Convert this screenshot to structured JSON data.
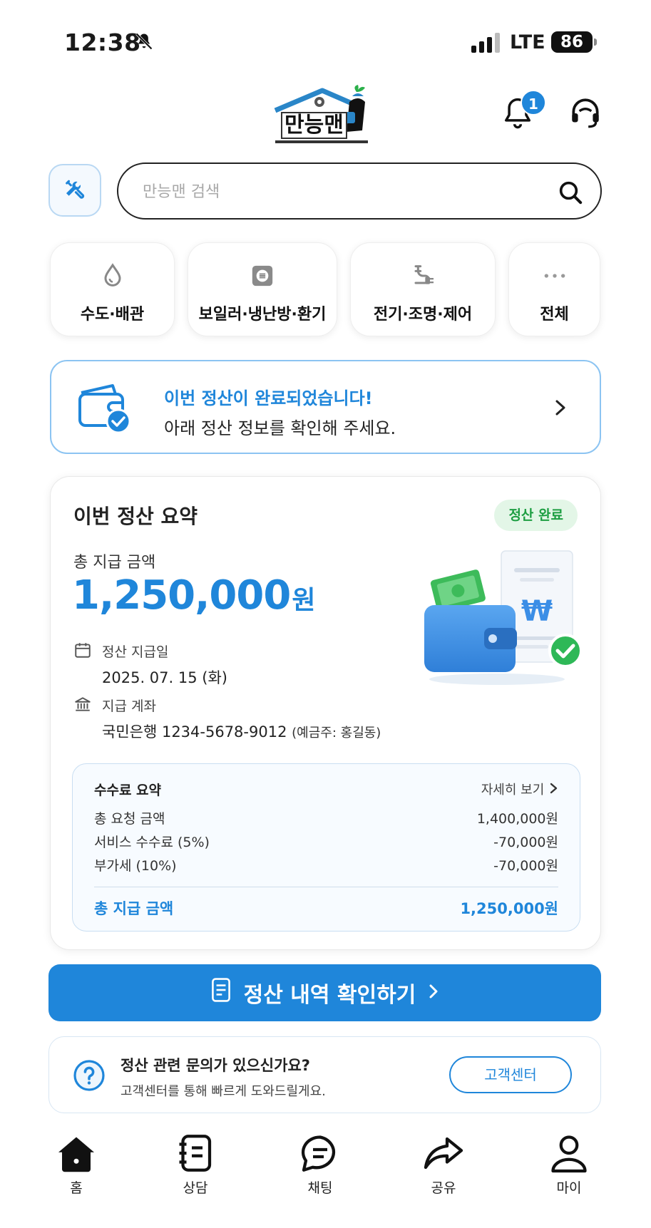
{
  "status_bar": {
    "time": "12:38",
    "network": "LTE",
    "battery": "86"
  },
  "header": {
    "logo_text": "만능맨",
    "notification_count": "1"
  },
  "search": {
    "placeholder": "만능맨 검색"
  },
  "categories": [
    {
      "label": "수도·배관",
      "icon": "water-drop-icon"
    },
    {
      "label": "보일러·냉난방·환기",
      "icon": "boiler-icon"
    },
    {
      "label": "전기·조명·제어",
      "icon": "plug-icon"
    },
    {
      "label": "전체",
      "icon": "more-dots-icon"
    }
  ],
  "notice": {
    "title": "이번 정산이 완료되었습니다!",
    "subtitle": "아래 정산 정보를 확인해 주세요."
  },
  "summary": {
    "title": "이번 정산 요약",
    "status_badge": "정산 완료",
    "total_label": "총 지급 금액",
    "total_amount": "1,250,000",
    "total_unit": "원",
    "payout_date_label": "정산 지급일",
    "payout_date": "2025. 07. 15 (화)",
    "account_label": "지급 계좌",
    "account": "국민은행 1234-5678-9012",
    "account_holder": "(예금주: 홍길동)",
    "illustration_symbol": "₩"
  },
  "fee_summary": {
    "title": "수수료 요약",
    "more_label": "자세히 보기",
    "rows": [
      {
        "label": "총 요청 금액",
        "value": "1,400,000원"
      },
      {
        "label": "서비스 수수료 (5%)",
        "value": "-70,000원"
      },
      {
        "label": "부가세 (10%)",
        "value": "-70,000원"
      }
    ],
    "total_label": "총 지급 금액",
    "total_value": "1,250,000원"
  },
  "cta": {
    "label": "정산 내역 확인하기"
  },
  "help": {
    "title": "정산 관련 문의가 있으신가요?",
    "subtitle": "고객센터를 통해 빠르게 도와드릴게요.",
    "button_label": "고객센터"
  },
  "tabbar": [
    {
      "label": "홈",
      "icon": "home-icon"
    },
    {
      "label": "상담",
      "icon": "consult-icon"
    },
    {
      "label": "채팅",
      "icon": "chat-icon"
    },
    {
      "label": "공유",
      "icon": "share-icon"
    },
    {
      "label": "마이",
      "icon": "profile-icon"
    }
  ],
  "colors": {
    "accent": "#1f86da",
    "success": "#1d9e42",
    "success_bg": "#e3f6e7"
  }
}
